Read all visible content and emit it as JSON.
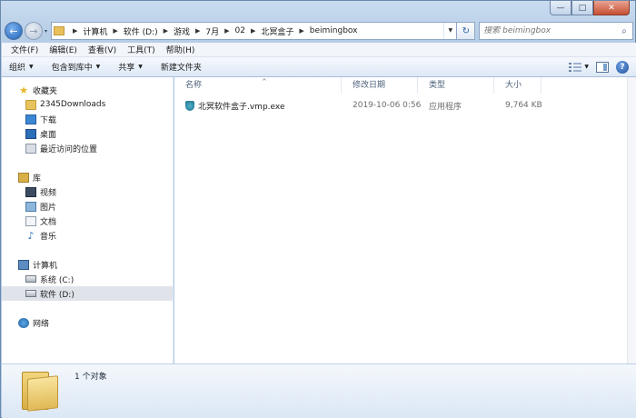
{
  "window": {
    "min_glyph": "—",
    "max_glyph": "□",
    "close_glyph": "✕"
  },
  "nav": {
    "back_glyph": "←",
    "forward_glyph": "→",
    "recent_glyph": "▾",
    "breadcrumb": [
      "计算机",
      "软件 (D:)",
      "游戏",
      "7月",
      "02",
      "北冥盒子",
      "beimingbox"
    ],
    "refresh_glyph": "↻",
    "search_placeholder": "搜索 beimingbox"
  },
  "menu": [
    "文件(F)",
    "编辑(E)",
    "查看(V)",
    "工具(T)",
    "帮助(H)"
  ],
  "commands": {
    "organize": "组织",
    "include_in_library": "包含到库中",
    "share": "共享",
    "new_folder": "新建文件夹"
  },
  "sidebar": {
    "favorites": {
      "label": "收藏夹",
      "items": [
        "2345Downloads",
        "下载",
        "桌面",
        "最近访问的位置"
      ]
    },
    "libraries": {
      "label": "库",
      "items": [
        "视频",
        "图片",
        "文档",
        "音乐"
      ]
    },
    "computer": {
      "label": "计算机",
      "items": [
        "系统 (C:)",
        "软件 (D:)"
      ]
    },
    "network": {
      "label": "网络"
    }
  },
  "columns": {
    "name": "名称",
    "date": "修改日期",
    "type": "类型",
    "size": "大小"
  },
  "files": [
    {
      "name": "北冥软件盒子.vmp.exe",
      "date": "2019-10-06 0:56",
      "type": "应用程序",
      "size": "9,764 KB"
    }
  ],
  "details": {
    "count_text": "1 个对象"
  }
}
